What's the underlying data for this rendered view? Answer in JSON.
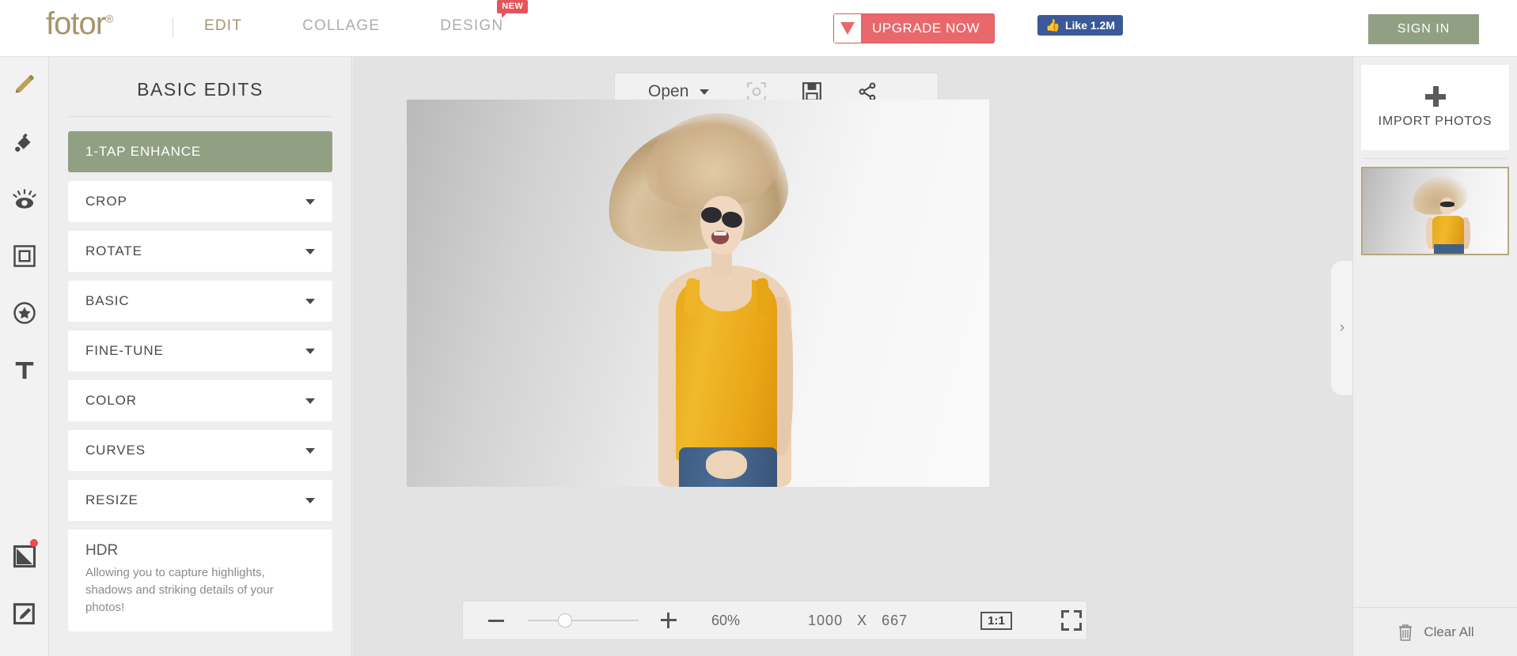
{
  "header": {
    "logo_text": "fotor",
    "logo_sup": "®",
    "nav": [
      {
        "label": "EDIT",
        "active": true
      },
      {
        "label": "COLLAGE",
        "active": false
      },
      {
        "label": "DESIGN",
        "active": false,
        "badge": "NEW"
      }
    ],
    "upgrade_label": "UPGRADE NOW",
    "like_label": "Like 1.2M",
    "signin_label": "SIGN IN",
    "accent_gold": "#a6956a",
    "accent_sage": "#91a083",
    "accent_red": "#e8686c",
    "facebook_blue": "#3b5998"
  },
  "rail": {
    "icons": [
      {
        "name": "edit-pencil-icon",
        "active": true
      },
      {
        "name": "beauty-retouch-icon",
        "active": false
      },
      {
        "name": "eye-effects-icon",
        "active": false
      },
      {
        "name": "frame-icon",
        "active": false
      },
      {
        "name": "sticker-star-icon",
        "active": false
      },
      {
        "name": "text-icon",
        "active": false
      }
    ],
    "bottom_icons": [
      {
        "name": "background-icon",
        "has_notification": true
      },
      {
        "name": "draw-icon",
        "has_notification": false
      }
    ]
  },
  "sidebar": {
    "title": "BASIC EDITS",
    "items": [
      {
        "label": "1-TAP ENHANCE",
        "highlighted": true,
        "has_caret": false
      },
      {
        "label": "CROP",
        "highlighted": false,
        "has_caret": true
      },
      {
        "label": "ROTATE",
        "highlighted": false,
        "has_caret": true
      },
      {
        "label": "BASIC",
        "highlighted": false,
        "has_caret": true
      },
      {
        "label": "FINE-TUNE",
        "highlighted": false,
        "has_caret": true
      },
      {
        "label": "COLOR",
        "highlighted": false,
        "has_caret": true
      },
      {
        "label": "CURVES",
        "highlighted": false,
        "has_caret": true
      },
      {
        "label": "RESIZE",
        "highlighted": false,
        "has_caret": true
      }
    ],
    "promo": {
      "title": "HDR",
      "description": "Allowing you to capture highlights, shadows and striking details of your photos!"
    }
  },
  "canvas": {
    "toolbar": {
      "open_label": "Open",
      "icons": [
        {
          "name": "screenshot-icon",
          "disabled": true
        },
        {
          "name": "save-icon",
          "disabled": false
        },
        {
          "name": "share-icon",
          "disabled": false
        }
      ]
    },
    "collapse_chevron": "›",
    "bottom": {
      "zoom_out_icon": "minus-icon",
      "zoom_in_icon": "plus-icon",
      "zoom_percent": "60%",
      "width": "1000",
      "separator": "X",
      "height": "667",
      "ratio_label": "1:1",
      "fullscreen_icon": "fullscreen-icon",
      "slider_position_pct": 27
    }
  },
  "right_panel": {
    "import_label": "IMPORT PHOTOS",
    "clear_label": "Clear All",
    "thumbnail_selected": true,
    "thumb_border_color": "#b8a87e"
  }
}
